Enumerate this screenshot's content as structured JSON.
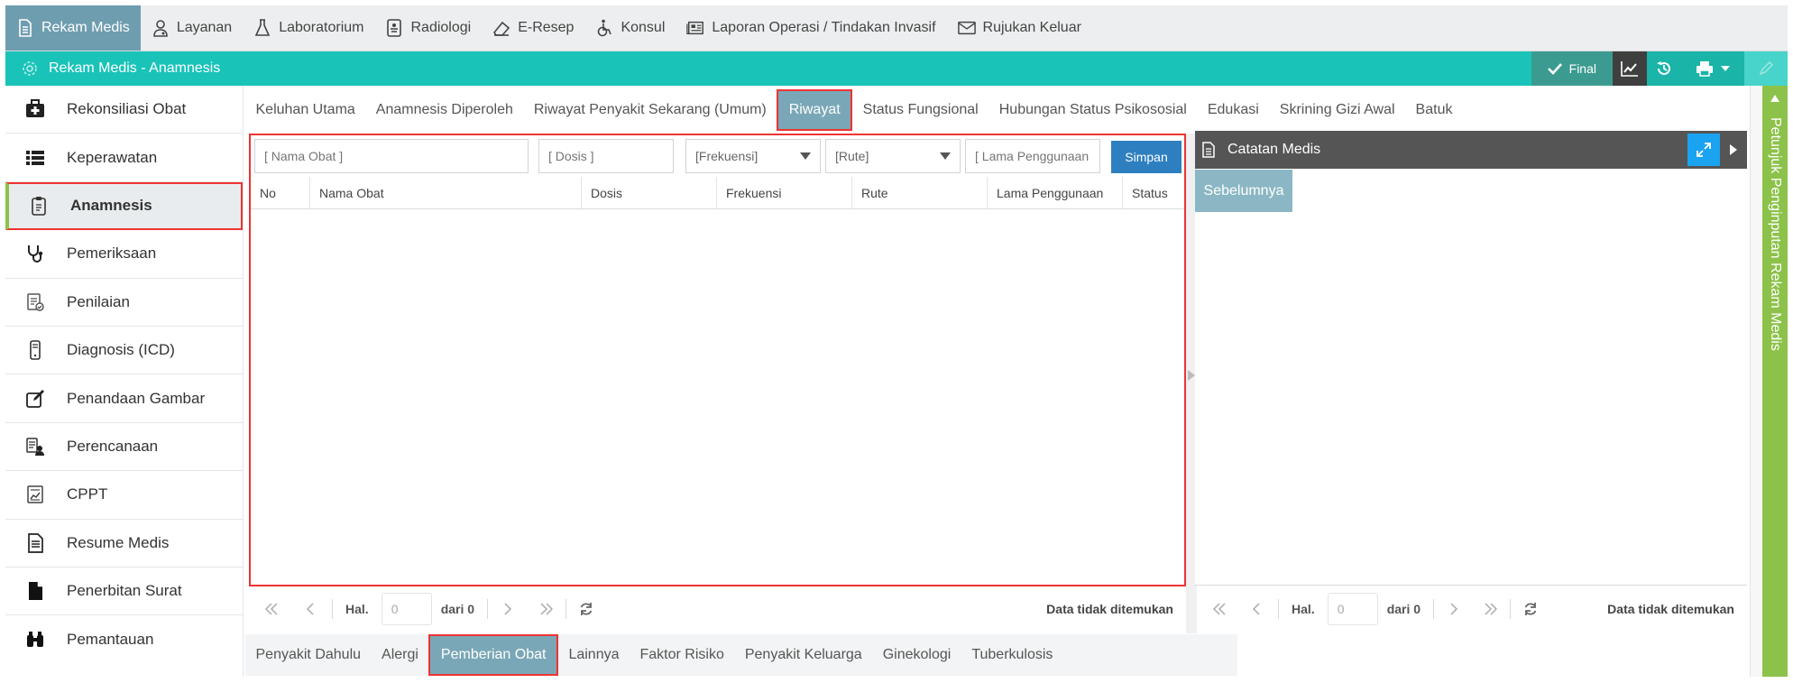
{
  "topnav": {
    "items": [
      {
        "label": "Rekam Medis",
        "icon": "document-icon",
        "active": true
      },
      {
        "label": "Layanan",
        "icon": "doctor-icon"
      },
      {
        "label": "Laboratorium",
        "icon": "flask-icon"
      },
      {
        "label": "Radiologi",
        "icon": "xray-icon"
      },
      {
        "label": "E-Resep",
        "icon": "eraser-icon"
      },
      {
        "label": "Konsul",
        "icon": "wheelchair-icon"
      },
      {
        "label": "Laporan Operasi / Tindakan Invasif",
        "icon": "newspaper-icon"
      },
      {
        "label": "Rujukan Keluar",
        "icon": "envelope-icon"
      }
    ]
  },
  "titlebar": {
    "title": "Rekam Medis - Anamnesis",
    "final_label": "Final"
  },
  "sidebar": {
    "items": [
      {
        "label": "Rekonsiliasi Obat",
        "icon": "medkit-icon"
      },
      {
        "label": "Keperawatan",
        "icon": "list-icon"
      },
      {
        "label": "Anamnesis",
        "icon": "clipboard-icon",
        "active": true
      },
      {
        "label": "Pemeriksaan",
        "icon": "stethoscope-icon"
      },
      {
        "label": "Penilaian",
        "icon": "assessment-icon"
      },
      {
        "label": "Diagnosis (ICD)",
        "icon": "mobile-icon"
      },
      {
        "label": "Penandaan Gambar",
        "icon": "edit-icon"
      },
      {
        "label": "Perencanaan",
        "icon": "planning-icon"
      },
      {
        "label": "CPPT",
        "icon": "chart-doc-icon"
      },
      {
        "label": "Resume Medis",
        "icon": "file-text-icon"
      },
      {
        "label": "Penerbitan Surat",
        "icon": "file-icon"
      },
      {
        "label": "Pemantauan",
        "icon": "binoculars-icon"
      }
    ]
  },
  "tabs_top": [
    {
      "label": "Keluhan Utama"
    },
    {
      "label": "Anamnesis Diperoleh"
    },
    {
      "label": "Riwayat Penyakit Sekarang (Umum)"
    },
    {
      "label": "Riwayat",
      "active": true
    },
    {
      "label": "Status Fungsional"
    },
    {
      "label": "Hubungan Status Psikososial"
    },
    {
      "label": "Edukasi"
    },
    {
      "label": "Skrining Gizi Awal"
    },
    {
      "label": "Batuk"
    }
  ],
  "form": {
    "nama_obat_placeholder": "[ Nama Obat ]",
    "dosis_placeholder": "[ Dosis ]",
    "frekuensi_value": "[Frekuensi]",
    "rute_value": "[Rute]",
    "lama_placeholder": "[ Lama Penggunaan ]",
    "simpan_label": "Simpan"
  },
  "grid": {
    "columns": [
      "No",
      "Nama Obat",
      "Dosis",
      "Frekuensi",
      "Rute",
      "Lama Penggunaan",
      "Status"
    ]
  },
  "pager_main": {
    "hal_label": "Hal.",
    "page_value": "0",
    "dari_label": "dari 0",
    "status": "Data tidak ditemukan"
  },
  "tabs_bottom": [
    {
      "label": "Penyakit Dahulu"
    },
    {
      "label": "Alergi"
    },
    {
      "label": "Pemberian Obat",
      "active": true
    },
    {
      "label": "Lainnya"
    },
    {
      "label": "Faktor Risiko"
    },
    {
      "label": "Penyakit Keluarga"
    },
    {
      "label": "Ginekologi"
    },
    {
      "label": "Tuberkulosis"
    }
  ],
  "catatan": {
    "title": "Catatan Medis",
    "tab_label": "Sebelumnya"
  },
  "pager_right": {
    "hal_label": "Hal.",
    "page_value": "0",
    "dari_label": "dari 0",
    "status": "Data tidak ditemukan"
  },
  "vertical_tab": {
    "label": "Petunjuk Penginputan Rekam Medis"
  },
  "colors": {
    "accent_teal": "#19c3b8",
    "active_tab": "#7aa7b7",
    "primary_button": "#2e7fbf",
    "highlight_border": "#e33333",
    "vertical_tab_green": "#8cc24a"
  }
}
